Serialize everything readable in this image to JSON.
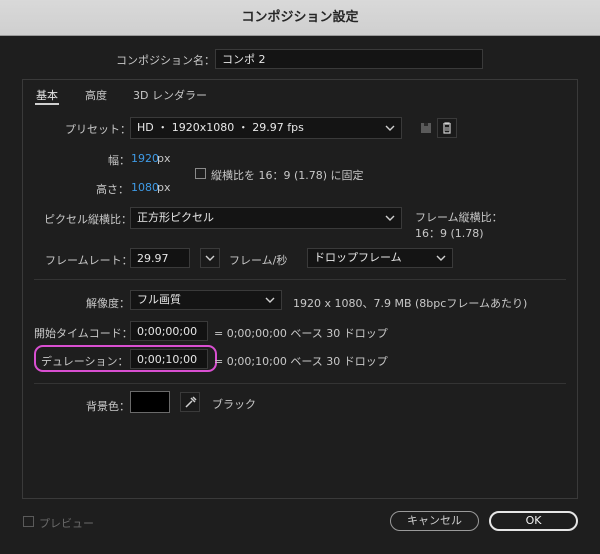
{
  "window": {
    "title": "コンポジション設定"
  },
  "comp_name": {
    "label": "コンポジション名：",
    "value": "コンポ 2"
  },
  "tabs": [
    {
      "label": "基本",
      "active": true
    },
    {
      "label": "高度",
      "active": false
    },
    {
      "label": "3D レンダラー",
      "active": false
    }
  ],
  "preset": {
    "label": "プリセット：",
    "value": "HD ・ 1920x1080 ・ 29.97 fps"
  },
  "width": {
    "label": "幅：",
    "value": "1920",
    "unit": "px"
  },
  "height": {
    "label": "高さ：",
    "value": "1080",
    "unit": "px"
  },
  "lock_aspect": {
    "label": "縦横比を 16：9 (1.78) に固定",
    "checked": false
  },
  "pixel_aspect": {
    "label": "ピクセル縦横比：",
    "value": "正方形ピクセル",
    "frame_aspect_label": "フレーム縦横比：",
    "frame_aspect_value": "16：9 (1.78)"
  },
  "frame_rate": {
    "label": "フレームレート：",
    "value": "29.97",
    "unit": "フレーム/秒",
    "drop_value": "ドロップフレーム"
  },
  "resolution": {
    "label": "解像度：",
    "value": "フル画質",
    "info": "1920 x 1080、7.9 MB (8bpcフレームあたり)"
  },
  "start_timecode": {
    "label": "開始タイムコード：",
    "value": "0;00;00;00",
    "info": "= 0;00;00;00 ベース 30 ドロップ"
  },
  "duration": {
    "label": "デュレーション：",
    "value": "0;00;10;00",
    "info": "= 0;00;10;00 ベース 30 ドロップ"
  },
  "background": {
    "label": "背景色：",
    "color": "#000000",
    "color_name": "ブラック"
  },
  "footer": {
    "preview_label": "プレビュー",
    "cancel_label": "キャンセル",
    "ok_label": "OK"
  },
  "colors": {
    "highlight": "#d94fd1",
    "link_blue": "#3f9be6"
  }
}
